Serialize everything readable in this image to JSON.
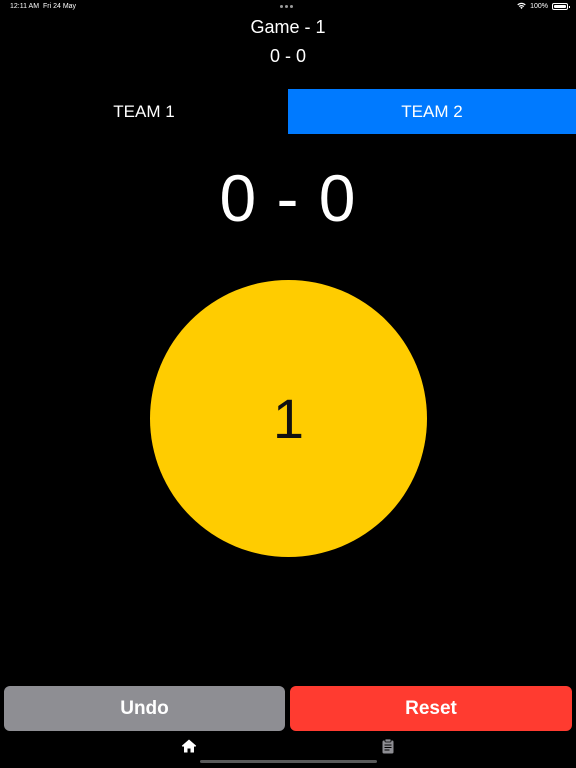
{
  "status_bar": {
    "time": "12:11 AM",
    "date": "Fri 24 May",
    "battery_percent": "100%"
  },
  "header": {
    "game_title": "Game - 1",
    "game_score": "0 - 0"
  },
  "team_tabs": [
    {
      "label": "TEAM 1",
      "selected": false
    },
    {
      "label": "TEAM 2",
      "selected": true
    }
  ],
  "scoreboard": {
    "score": "0 - 0"
  },
  "counter_button": {
    "label": "1",
    "color": "#ffcc00"
  },
  "actions": {
    "undo_label": "Undo",
    "reset_label": "Reset"
  },
  "tab_bar": {
    "items": [
      {
        "icon": "home-icon",
        "selected": true
      },
      {
        "icon": "clipboard-icon",
        "selected": false
      }
    ]
  },
  "colors": {
    "accent": "#007aff",
    "reset": "#ff3b30",
    "undo": "#8e8e93",
    "counter": "#ffcc00",
    "background": "#000000"
  }
}
